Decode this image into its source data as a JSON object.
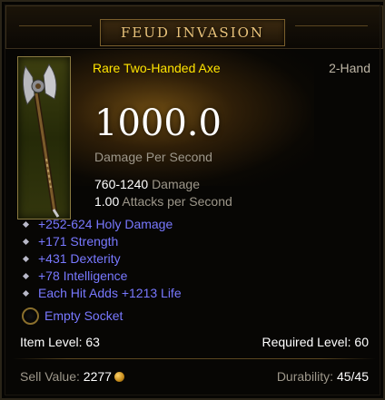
{
  "header": {
    "title": "FEUD INVASION"
  },
  "item": {
    "name": "Rare Two-Handed Axe",
    "slot": "2-Hand",
    "dps": "1000.0",
    "dps_label": "Damage Per Second",
    "damage_range": "760-1240",
    "damage_label": "Damage",
    "attack_speed": "1.00",
    "attack_speed_label": "Attacks per Second",
    "icon": "two-handed-axe-icon"
  },
  "affixes": [
    "+252-624 Holy Damage",
    "+171 Strength",
    "+431 Dexterity",
    "+78 Intelligence",
    "Each Hit Adds +1213 Life"
  ],
  "socket": {
    "label": "Empty Socket"
  },
  "levels": {
    "item_level_label": "Item Level:",
    "item_level": "63",
    "required_level_label": "Required Level:",
    "required_level": "60"
  },
  "footer": {
    "sell_label": "Sell Value:",
    "sell_value": "2277",
    "durability_label": "Durability:",
    "durability_value": "45/45"
  },
  "colors": {
    "rare": "#ffe400",
    "magic": "#7878ff",
    "title": "#e8c27a"
  }
}
